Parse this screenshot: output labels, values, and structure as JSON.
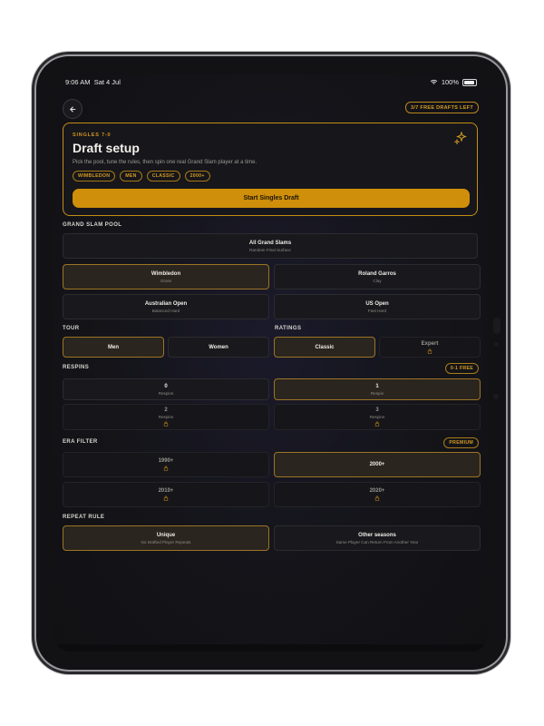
{
  "status": {
    "time": "9:06 AM",
    "date": "Sat 4 Jul",
    "battery": "100%"
  },
  "header": {
    "free_drafts": "3/7 FREE DRAFTS LEFT"
  },
  "hero": {
    "eyebrow": "SINGLES 7-0",
    "title": "Draft setup",
    "description": "Pick the pool, tune the rules, then spin one real Grand Slam player at a time.",
    "tags": [
      "WIMBLEDON",
      "MEN",
      "CLASSIC",
      "2000+"
    ],
    "start_label": "Start Singles Draft"
  },
  "pool": {
    "label": "GRAND SLAM POOL",
    "all": {
      "title": "All Grand Slams",
      "sub": "Random Final Surface"
    },
    "items": [
      {
        "title": "Wimbledon",
        "sub": "Grass"
      },
      {
        "title": "Roland Garros",
        "sub": "Clay"
      },
      {
        "title": "Australian Open",
        "sub": "Balanced Hard"
      },
      {
        "title": "US Open",
        "sub": "Fast Hard"
      }
    ]
  },
  "tour": {
    "label": "TOUR",
    "men": "Men",
    "women": "Women"
  },
  "ratings": {
    "label": "RATINGS",
    "classic": "Classic",
    "expert": "Expert"
  },
  "respins": {
    "label": "RESPINS",
    "badge": "0-1 FREE",
    "items": [
      {
        "title": "0",
        "sub": "Respins"
      },
      {
        "title": "1",
        "sub": "Respin"
      },
      {
        "title": "2",
        "sub": "Respins"
      },
      {
        "title": "3",
        "sub": "Respins"
      }
    ]
  },
  "era": {
    "label": "ERA FILTER",
    "badge": "PREMIUM",
    "items": [
      "1990+",
      "2000+",
      "2010+",
      "2020+"
    ]
  },
  "repeat": {
    "label": "REPEAT RULE",
    "unique": {
      "title": "Unique",
      "sub": "No Drafted Player Repeats"
    },
    "other": {
      "title": "Other seasons",
      "sub": "Same Player Can Return From Another Year"
    }
  },
  "colors": {
    "accent": "#cf8f0a",
    "background": "#141419"
  }
}
